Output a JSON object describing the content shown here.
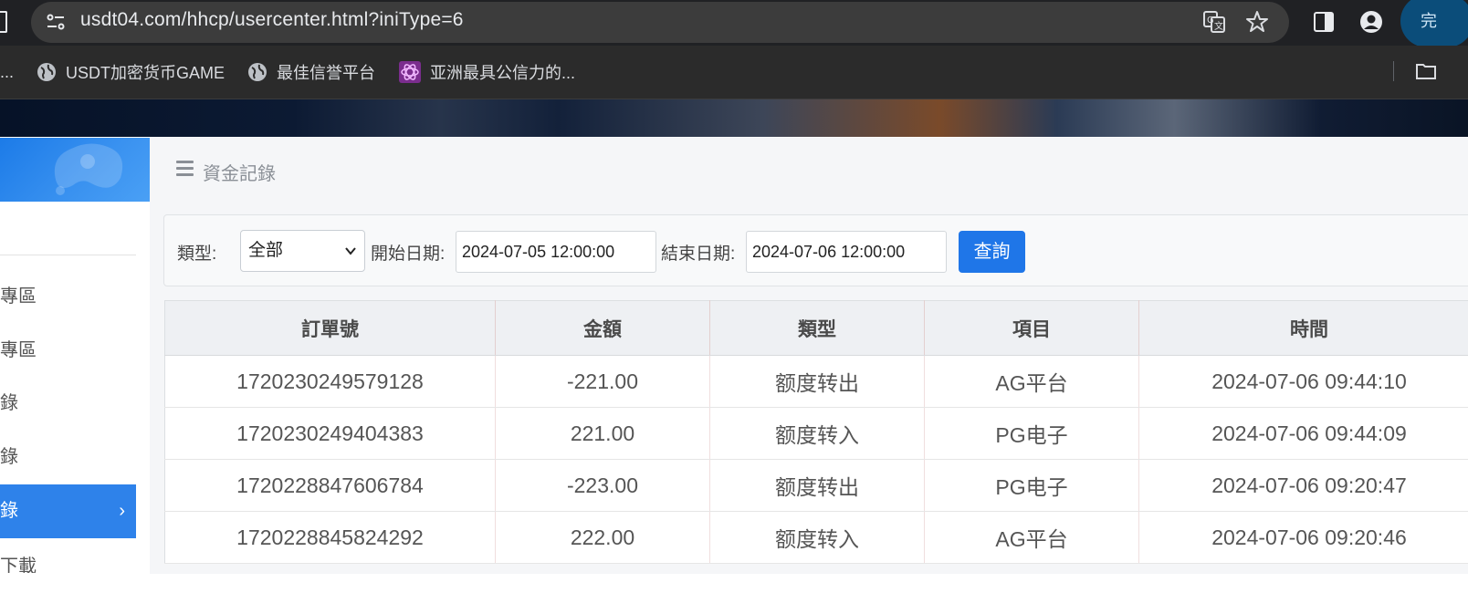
{
  "browser": {
    "url": "usdt04.com/hhcp/usercenter.html?iniType=6",
    "profile_char": "完",
    "bookmarks": [
      {
        "label": "..."
      },
      {
        "label": "USDT加密货币GAME"
      },
      {
        "label": "最佳信誉平台"
      },
      {
        "label": "亚洲最具公信力的..."
      }
    ]
  },
  "sidebar": {
    "items": [
      {
        "label": "專區"
      },
      {
        "label": "專區"
      },
      {
        "label": "錄"
      },
      {
        "label": "錄"
      },
      {
        "label": "錄",
        "active": true
      },
      {
        "label": "下載"
      }
    ],
    "active_color": "#2e82ea"
  },
  "breadcrumb": {
    "title": "資金記錄"
  },
  "filter": {
    "type_label": "類型:",
    "type_value": "全部",
    "start_label": "開始日期:",
    "start_value": "2024-07-05 12:00:00",
    "end_label": "結束日期:",
    "end_value": "2024-07-06 12:00:00",
    "query_label": "查詢",
    "query_color": "#1f76e8"
  },
  "table": {
    "headers": [
      "訂單號",
      "金額",
      "類型",
      "項目",
      "時間"
    ],
    "rows": [
      [
        "1720230249579128",
        "-221.00",
        "额度转出",
        "AG平台",
        "2024-07-06 09:44:10"
      ],
      [
        "1720230249404383",
        "221.00",
        "额度转入",
        "PG电子",
        "2024-07-06 09:44:09"
      ],
      [
        "1720228847606784",
        "-223.00",
        "额度转出",
        "PG电子",
        "2024-07-06 09:20:47"
      ],
      [
        "1720228845824292",
        "222.00",
        "额度转入",
        "AG平台",
        "2024-07-06 09:20:46"
      ]
    ]
  }
}
